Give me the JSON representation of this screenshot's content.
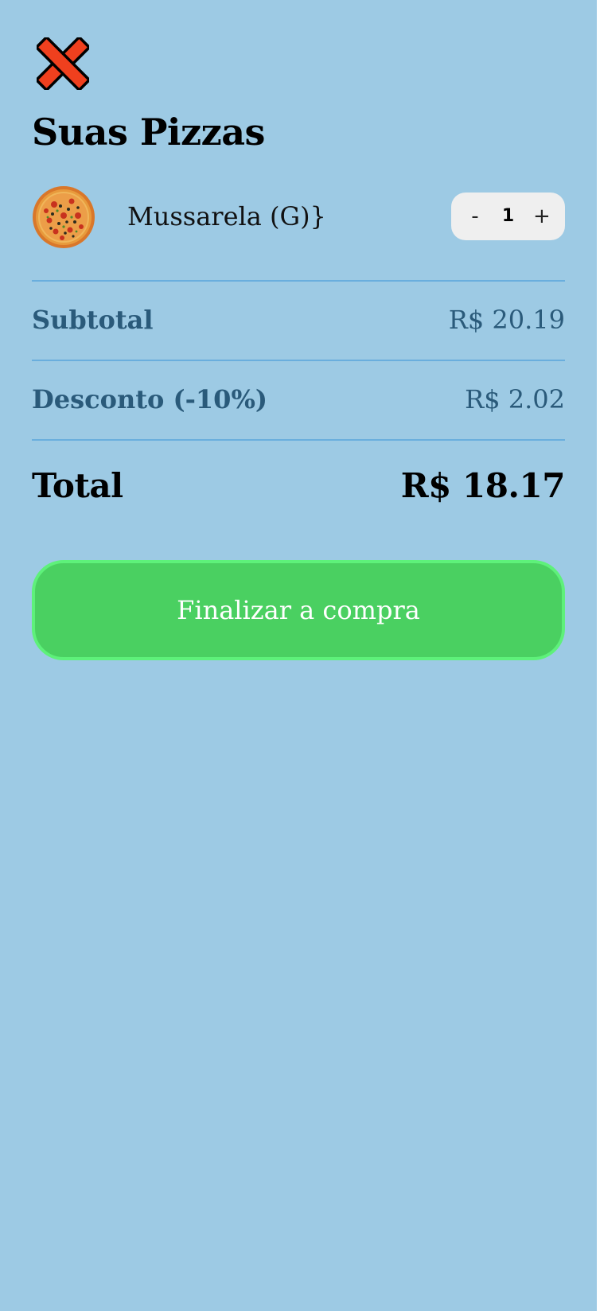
{
  "cart": {
    "close_icon": "close-x-icon",
    "title": "Suas Pizzas",
    "items": [
      {
        "thumbnail": "pizza-icon",
        "name": "Mussarela (G)}",
        "decrement_label": "-",
        "quantity": "1",
        "increment_label": "+"
      }
    ],
    "subtotal": {
      "label": "Subtotal",
      "value": "R$ 20.19"
    },
    "discount": {
      "label": "Desconto (-10%)",
      "value": "R$ 2.02"
    },
    "total": {
      "label": "Total",
      "value": "R$ 18.17"
    },
    "checkout_label": "Finalizar a compra"
  },
  "colors": {
    "background": "#9dcae4",
    "divider": "#6aaedd",
    "close_icon": "#f0401e",
    "muted_text": "#2a5a7a",
    "stepper_bg": "#efefef",
    "checkout_bg": "#4ad061",
    "checkout_border": "#5ef17a"
  }
}
